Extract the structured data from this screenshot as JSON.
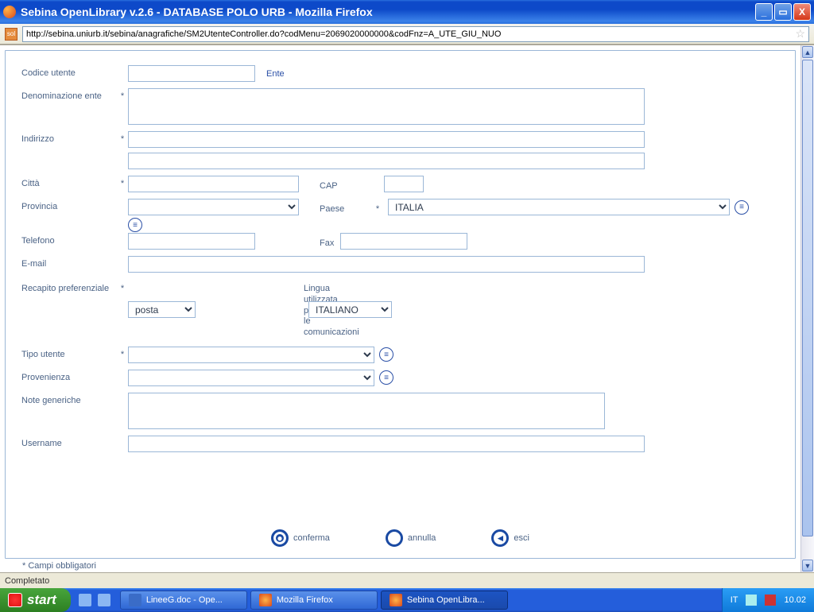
{
  "window": {
    "title": "Sebina OpenLibrary v.2.6 - DATABASE POLO URB - Mozilla Firefox",
    "url": "http://sebina.uniurb.it/sebina/anagrafiche/SM2UtenteController.do?codMenu=2069020000000&codFnz=A_UTE_GIU_NUO"
  },
  "form": {
    "codice_utente_label": "Codice utente",
    "codice_utente_value": "",
    "ente_link": "Ente",
    "denominazione_label": "Denominazione ente",
    "denominazione_value": "",
    "indirizzo_label": "Indirizzo",
    "indirizzo1_value": "",
    "indirizzo2_value": "",
    "citta_label": "Città",
    "citta_value": "",
    "cap_label": "CAP",
    "cap_value": "",
    "provincia_label": "Provincia",
    "provincia_value": "",
    "paese_label": "Paese",
    "paese_value": "ITALIA",
    "telefono_label": "Telefono",
    "telefono_value": "",
    "fax_label": "Fax",
    "fax_value": "",
    "email_label": "E-mail",
    "email_value": "",
    "recapito_label": "Recapito preferenziale",
    "recapito_value": "posta",
    "lingua_label": "Lingua utilizzata per le comunicazioni",
    "lingua_value": "ITALIANO",
    "tipo_utente_label": "Tipo utente",
    "tipo_utente_value": "",
    "provenienza_label": "Provenienza",
    "provenienza_value": "",
    "note_label": "Note generiche",
    "note_value": "",
    "username_label": "Username",
    "username_value": "",
    "required_note": "* Campi obbligatori"
  },
  "actions": {
    "conferma": "conferma",
    "annulla": "annulla",
    "esci": "esci"
  },
  "status": {
    "text": "Completato"
  },
  "taskbar": {
    "start": "start",
    "btn1": "LineeG.doc - Ope...",
    "btn2": "Mozilla Firefox",
    "btn3": "Sebina OpenLibra...",
    "lang": "IT",
    "clock": "10.02"
  }
}
